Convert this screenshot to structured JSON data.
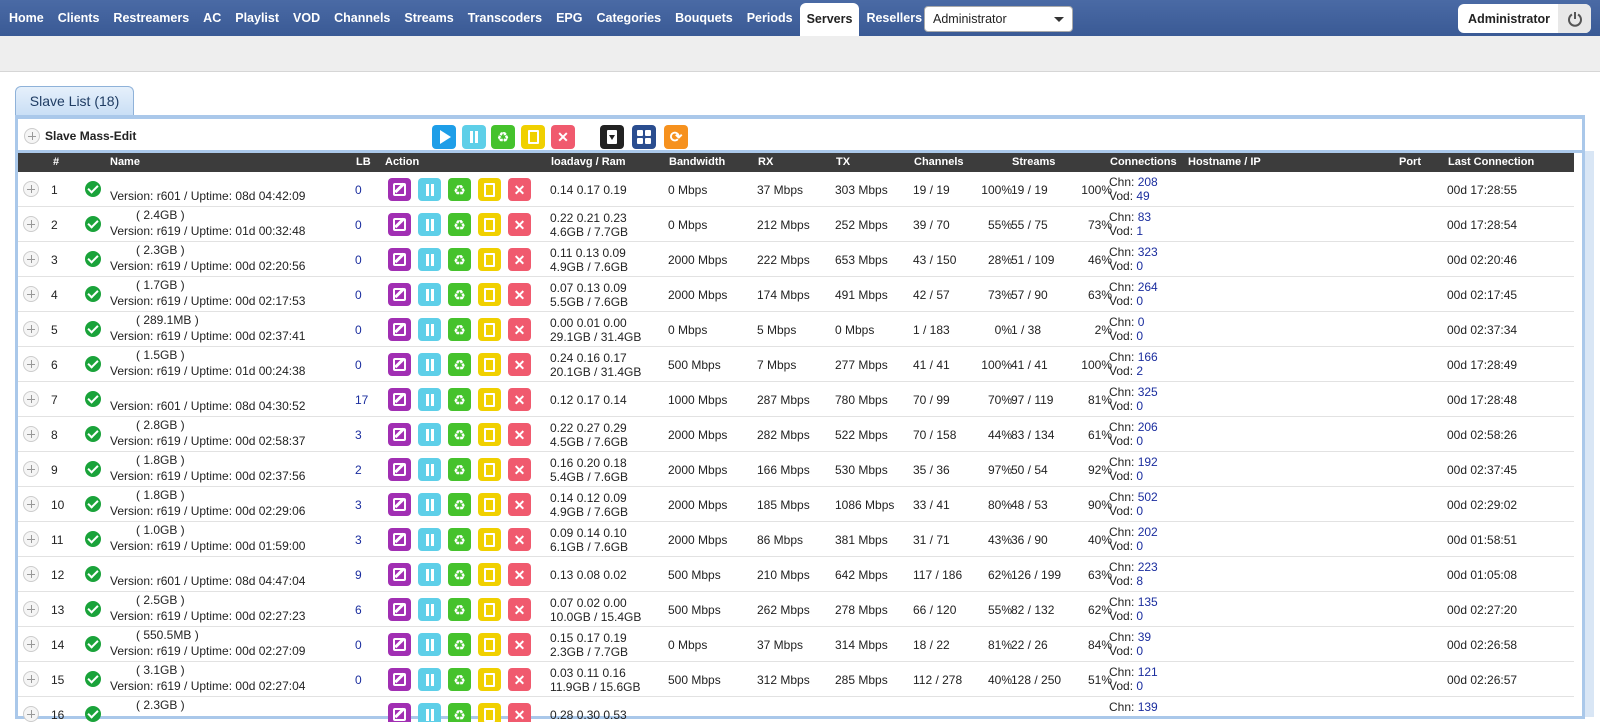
{
  "nav": {
    "items": [
      "Home",
      "Clients",
      "Restreamers",
      "AC",
      "Playlist",
      "VOD",
      "Channels",
      "Streams",
      "Transcoders",
      "EPG",
      "Categories",
      "Bouquets",
      "Periods",
      "Servers",
      "Resellers"
    ],
    "active": "Servers",
    "role_select": "Administrator",
    "user": "Administrator"
  },
  "tab": {
    "label": "Slave List (18)"
  },
  "mass": {
    "label": "Slave Mass-Edit"
  },
  "colors": {
    "nav": "#3b5998",
    "purple": "#a12fb3",
    "cyan": "#5ecfe8",
    "green": "#45c22c",
    "yellow": "#f0d000",
    "red": "#f05a6e",
    "black": "#222222",
    "navy": "#2a4d8f",
    "orange": "#f6911e",
    "blue_btn": "#1e9ee8"
  },
  "table": {
    "headers": [
      "#",
      "Name",
      "LB",
      "Action",
      "loadavg / Ram",
      "Bandwidth",
      "RX",
      "TX",
      "Channels",
      "Streams",
      "Connections",
      "Hostname / IP",
      "Port",
      "Last Connection"
    ],
    "rows": [
      {
        "n": "1",
        "ram": "",
        "ver": "Version: r601 / Uptime: 08d 04:42:09",
        "lb": "0",
        "load": "0.14 0.17 0.19",
        "mem": "",
        "bw": "0 Mbps",
        "rx": "37 Mbps",
        "tx": "303 Mbps",
        "ch": "19 / 19",
        "chp": "100%",
        "st": "19 / 19",
        "stp": "100%",
        "chn": "208",
        "vod": "49",
        "last": "00d 17:28:55"
      },
      {
        "n": "2",
        "ram": "( 2.4GB )",
        "ver": "Version: r619 / Uptime: 01d 00:32:48",
        "lb": "0",
        "load": "0.22 0.21 0.23",
        "mem": "4.6GB / 7.7GB",
        "bw": "0 Mbps",
        "rx": "212 Mbps",
        "tx": "252 Mbps",
        "ch": "39 / 70",
        "chp": "55%",
        "st": "55 / 75",
        "stp": "73%",
        "chn": "83",
        "vod": "1",
        "last": "00d 17:28:54"
      },
      {
        "n": "3",
        "ram": "( 2.3GB )",
        "ver": "Version: r619 / Uptime: 00d 02:20:56",
        "lb": "0",
        "load": "0.11 0.13 0.09",
        "mem": "4.9GB / 7.6GB",
        "bw": "2000 Mbps",
        "rx": "222 Mbps",
        "tx": "653 Mbps",
        "ch": "43 / 150",
        "chp": "28%",
        "st": "51 / 109",
        "stp": "46%",
        "chn": "323",
        "vod": "0",
        "last": "00d 02:20:46"
      },
      {
        "n": "4",
        "ram": "( 1.7GB )",
        "ver": "Version: r619 / Uptime: 00d 02:17:53",
        "lb": "0",
        "load": "0.07 0.13 0.09",
        "mem": "5.5GB / 7.6GB",
        "bw": "2000 Mbps",
        "rx": "174 Mbps",
        "tx": "491 Mbps",
        "ch": "42 / 57",
        "chp": "73%",
        "st": "57 / 90",
        "stp": "63%",
        "chn": "264",
        "vod": "0",
        "last": "00d 02:17:45"
      },
      {
        "n": "5",
        "ram": "( 289.1MB )",
        "ver": "Version: r619 / Uptime: 00d 02:37:41",
        "lb": "0",
        "load": "0.00 0.01 0.00",
        "mem": "29.1GB / 31.4GB",
        "bw": "0 Mbps",
        "rx": "5 Mbps",
        "tx": "0 Mbps",
        "ch": "1 / 183",
        "chp": "0%",
        "st": "1 / 38",
        "stp": "2%",
        "chn": "0",
        "vod": "0",
        "last": "00d 02:37:34"
      },
      {
        "n": "6",
        "ram": "( 1.5GB )",
        "ver": "Version: r619 / Uptime: 01d 00:24:38",
        "lb": "0",
        "load": "0.24 0.16 0.17",
        "mem": "20.1GB / 31.4GB",
        "bw": "500 Mbps",
        "rx": "7 Mbps",
        "tx": "277 Mbps",
        "ch": "41 / 41",
        "chp": "100%",
        "st": "41 / 41",
        "stp": "100%",
        "chn": "166",
        "vod": "2",
        "last": "00d 17:28:49"
      },
      {
        "n": "7",
        "ram": "",
        "ver": "Version: r601 / Uptime: 08d 04:30:52",
        "lb": "17",
        "load": "0.12 0.17 0.14",
        "mem": "",
        "bw": "1000 Mbps",
        "rx": "287 Mbps",
        "tx": "780 Mbps",
        "ch": "70 / 99",
        "chp": "70%",
        "st": "97 / 119",
        "stp": "81%",
        "chn": "325",
        "vod": "0",
        "last": "00d 17:28:48"
      },
      {
        "n": "8",
        "ram": "( 2.8GB )",
        "ver": "Version: r619 / Uptime: 00d 02:58:37",
        "lb": "3",
        "load": "0.22 0.27 0.29",
        "mem": "4.5GB / 7.6GB",
        "bw": "2000 Mbps",
        "rx": "282 Mbps",
        "tx": "522 Mbps",
        "ch": "70 / 158",
        "chp": "44%",
        "st": "83 / 134",
        "stp": "61%",
        "chn": "206",
        "vod": "0",
        "last": "00d 02:58:26"
      },
      {
        "n": "9",
        "ram": "( 1.8GB )",
        "ver": "Version: r619 / Uptime: 00d 02:37:56",
        "lb": "2",
        "load": "0.16 0.20 0.18",
        "mem": "5.4GB / 7.6GB",
        "bw": "2000 Mbps",
        "rx": "166 Mbps",
        "tx": "530 Mbps",
        "ch": "35 / 36",
        "chp": "97%",
        "st": "50 / 54",
        "stp": "92%",
        "chn": "192",
        "vod": "0",
        "last": "00d 02:37:45"
      },
      {
        "n": "10",
        "ram": "( 1.8GB )",
        "ver": "Version: r619 / Uptime: 00d 02:29:06",
        "lb": "3",
        "load": "0.14 0.12 0.09",
        "mem": "4.9GB / 7.6GB",
        "bw": "2000 Mbps",
        "rx": "185 Mbps",
        "tx": "1086 Mbps",
        "ch": "33 / 41",
        "chp": "80%",
        "st": "48 / 53",
        "stp": "90%",
        "chn": "502",
        "vod": "0",
        "last": "00d 02:29:02"
      },
      {
        "n": "11",
        "ram": "( 1.0GB )",
        "ver": "Version: r619 / Uptime: 00d 01:59:00",
        "lb": "3",
        "load": "0.09 0.14 0.10",
        "mem": "6.1GB / 7.6GB",
        "bw": "2000 Mbps",
        "rx": "86 Mbps",
        "tx": "381 Mbps",
        "ch": "31 / 71",
        "chp": "43%",
        "st": "36 / 90",
        "stp": "40%",
        "chn": "202",
        "vod": "0",
        "last": "00d 01:58:51"
      },
      {
        "n": "12",
        "ram": "",
        "ver": "Version: r601 / Uptime: 08d 04:47:04",
        "lb": "9",
        "load": "0.13 0.08 0.02",
        "mem": "",
        "bw": "500 Mbps",
        "rx": "210 Mbps",
        "tx": "642 Mbps",
        "ch": "117 / 186",
        "chp": "62%",
        "st": "126 / 199",
        "stp": "63%",
        "chn": "223",
        "vod": "8",
        "last": "00d 01:05:08"
      },
      {
        "n": "13",
        "ram": "( 2.5GB )",
        "ver": "Version: r619 / Uptime: 00d 02:27:23",
        "lb": "6",
        "load": "0.07 0.02 0.00",
        "mem": "10.0GB / 15.4GB",
        "bw": "500 Mbps",
        "rx": "262 Mbps",
        "tx": "278 Mbps",
        "ch": "66 / 120",
        "chp": "55%",
        "st": "82 / 132",
        "stp": "62%",
        "chn": "135",
        "vod": "0",
        "last": "00d 02:27:20"
      },
      {
        "n": "14",
        "ram": "( 550.5MB )",
        "ver": "Version: r619 / Uptime: 00d 02:27:09",
        "lb": "0",
        "load": "0.15 0.17 0.19",
        "mem": "2.3GB / 7.7GB",
        "bw": "0 Mbps",
        "rx": "37 Mbps",
        "tx": "314 Mbps",
        "ch": "18 / 22",
        "chp": "81%",
        "st": "22 / 26",
        "stp": "84%",
        "chn": "39",
        "vod": "0",
        "last": "00d 02:26:58"
      },
      {
        "n": "15",
        "ram": "( 3.1GB )",
        "ver": "Version: r619 / Uptime: 00d 02:27:04",
        "lb": "0",
        "load": "0.03 0.11 0.16",
        "mem": "11.9GB / 15.6GB",
        "bw": "500 Mbps",
        "rx": "312 Mbps",
        "tx": "285 Mbps",
        "ch": "112 / 278",
        "chp": "40%",
        "st": "128 / 250",
        "stp": "51%",
        "chn": "121",
        "vod": "0",
        "last": "00d 02:26:57"
      },
      {
        "n": "16",
        "ram": "( 2.3GB )",
        "ver": "",
        "lb": "",
        "load": "0.28 0.30 0.53",
        "mem": "",
        "bw": "",
        "rx": "",
        "tx": "",
        "ch": "",
        "chp": "",
        "st": "",
        "stp": "",
        "chn": "139",
        "vod": "",
        "last": ""
      }
    ]
  },
  "labels": {
    "chn": "Chn: ",
    "vod": "Vod: "
  }
}
